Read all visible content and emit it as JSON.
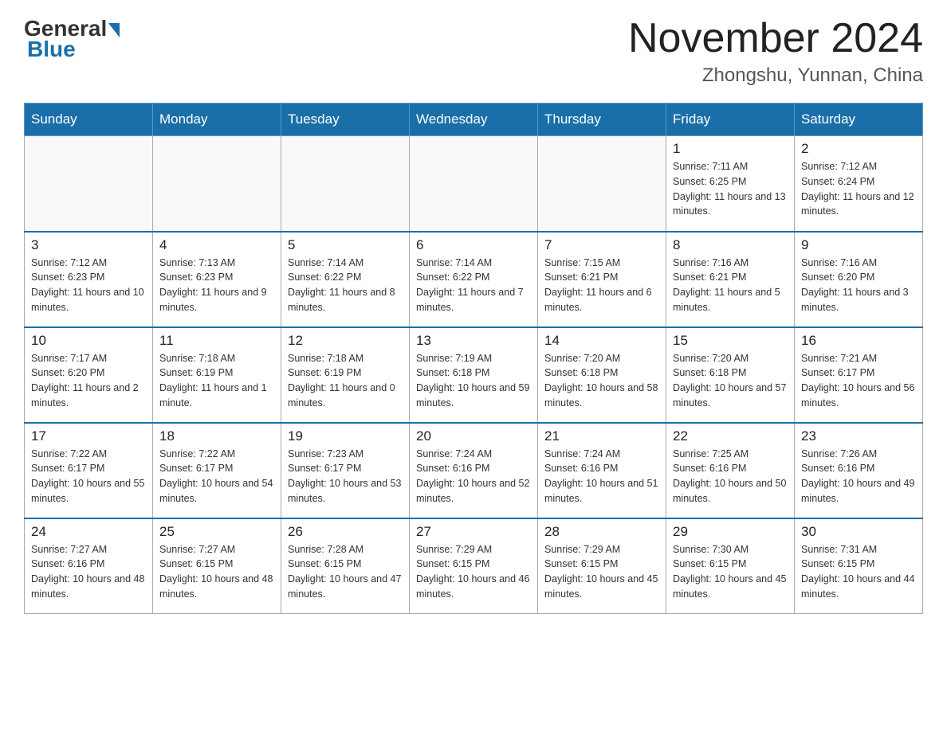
{
  "header": {
    "logo_general": "General",
    "logo_blue": "Blue",
    "month_title": "November 2024",
    "location": "Zhongshu, Yunnan, China"
  },
  "weekdays": [
    "Sunday",
    "Monday",
    "Tuesday",
    "Wednesday",
    "Thursday",
    "Friday",
    "Saturday"
  ],
  "weeks": [
    [
      {
        "day": "",
        "sunrise": "",
        "sunset": "",
        "daylight": ""
      },
      {
        "day": "",
        "sunrise": "",
        "sunset": "",
        "daylight": ""
      },
      {
        "day": "",
        "sunrise": "",
        "sunset": "",
        "daylight": ""
      },
      {
        "day": "",
        "sunrise": "",
        "sunset": "",
        "daylight": ""
      },
      {
        "day": "",
        "sunrise": "",
        "sunset": "",
        "daylight": ""
      },
      {
        "day": "1",
        "sunrise": "Sunrise: 7:11 AM",
        "sunset": "Sunset: 6:25 PM",
        "daylight": "Daylight: 11 hours and 13 minutes."
      },
      {
        "day": "2",
        "sunrise": "Sunrise: 7:12 AM",
        "sunset": "Sunset: 6:24 PM",
        "daylight": "Daylight: 11 hours and 12 minutes."
      }
    ],
    [
      {
        "day": "3",
        "sunrise": "Sunrise: 7:12 AM",
        "sunset": "Sunset: 6:23 PM",
        "daylight": "Daylight: 11 hours and 10 minutes."
      },
      {
        "day": "4",
        "sunrise": "Sunrise: 7:13 AM",
        "sunset": "Sunset: 6:23 PM",
        "daylight": "Daylight: 11 hours and 9 minutes."
      },
      {
        "day": "5",
        "sunrise": "Sunrise: 7:14 AM",
        "sunset": "Sunset: 6:22 PM",
        "daylight": "Daylight: 11 hours and 8 minutes."
      },
      {
        "day": "6",
        "sunrise": "Sunrise: 7:14 AM",
        "sunset": "Sunset: 6:22 PM",
        "daylight": "Daylight: 11 hours and 7 minutes."
      },
      {
        "day": "7",
        "sunrise": "Sunrise: 7:15 AM",
        "sunset": "Sunset: 6:21 PM",
        "daylight": "Daylight: 11 hours and 6 minutes."
      },
      {
        "day": "8",
        "sunrise": "Sunrise: 7:16 AM",
        "sunset": "Sunset: 6:21 PM",
        "daylight": "Daylight: 11 hours and 5 minutes."
      },
      {
        "day": "9",
        "sunrise": "Sunrise: 7:16 AM",
        "sunset": "Sunset: 6:20 PM",
        "daylight": "Daylight: 11 hours and 3 minutes."
      }
    ],
    [
      {
        "day": "10",
        "sunrise": "Sunrise: 7:17 AM",
        "sunset": "Sunset: 6:20 PM",
        "daylight": "Daylight: 11 hours and 2 minutes."
      },
      {
        "day": "11",
        "sunrise": "Sunrise: 7:18 AM",
        "sunset": "Sunset: 6:19 PM",
        "daylight": "Daylight: 11 hours and 1 minute."
      },
      {
        "day": "12",
        "sunrise": "Sunrise: 7:18 AM",
        "sunset": "Sunset: 6:19 PM",
        "daylight": "Daylight: 11 hours and 0 minutes."
      },
      {
        "day": "13",
        "sunrise": "Sunrise: 7:19 AM",
        "sunset": "Sunset: 6:18 PM",
        "daylight": "Daylight: 10 hours and 59 minutes."
      },
      {
        "day": "14",
        "sunrise": "Sunrise: 7:20 AM",
        "sunset": "Sunset: 6:18 PM",
        "daylight": "Daylight: 10 hours and 58 minutes."
      },
      {
        "day": "15",
        "sunrise": "Sunrise: 7:20 AM",
        "sunset": "Sunset: 6:18 PM",
        "daylight": "Daylight: 10 hours and 57 minutes."
      },
      {
        "day": "16",
        "sunrise": "Sunrise: 7:21 AM",
        "sunset": "Sunset: 6:17 PM",
        "daylight": "Daylight: 10 hours and 56 minutes."
      }
    ],
    [
      {
        "day": "17",
        "sunrise": "Sunrise: 7:22 AM",
        "sunset": "Sunset: 6:17 PM",
        "daylight": "Daylight: 10 hours and 55 minutes."
      },
      {
        "day": "18",
        "sunrise": "Sunrise: 7:22 AM",
        "sunset": "Sunset: 6:17 PM",
        "daylight": "Daylight: 10 hours and 54 minutes."
      },
      {
        "day": "19",
        "sunrise": "Sunrise: 7:23 AM",
        "sunset": "Sunset: 6:17 PM",
        "daylight": "Daylight: 10 hours and 53 minutes."
      },
      {
        "day": "20",
        "sunrise": "Sunrise: 7:24 AM",
        "sunset": "Sunset: 6:16 PM",
        "daylight": "Daylight: 10 hours and 52 minutes."
      },
      {
        "day": "21",
        "sunrise": "Sunrise: 7:24 AM",
        "sunset": "Sunset: 6:16 PM",
        "daylight": "Daylight: 10 hours and 51 minutes."
      },
      {
        "day": "22",
        "sunrise": "Sunrise: 7:25 AM",
        "sunset": "Sunset: 6:16 PM",
        "daylight": "Daylight: 10 hours and 50 minutes."
      },
      {
        "day": "23",
        "sunrise": "Sunrise: 7:26 AM",
        "sunset": "Sunset: 6:16 PM",
        "daylight": "Daylight: 10 hours and 49 minutes."
      }
    ],
    [
      {
        "day": "24",
        "sunrise": "Sunrise: 7:27 AM",
        "sunset": "Sunset: 6:16 PM",
        "daylight": "Daylight: 10 hours and 48 minutes."
      },
      {
        "day": "25",
        "sunrise": "Sunrise: 7:27 AM",
        "sunset": "Sunset: 6:15 PM",
        "daylight": "Daylight: 10 hours and 48 minutes."
      },
      {
        "day": "26",
        "sunrise": "Sunrise: 7:28 AM",
        "sunset": "Sunset: 6:15 PM",
        "daylight": "Daylight: 10 hours and 47 minutes."
      },
      {
        "day": "27",
        "sunrise": "Sunrise: 7:29 AM",
        "sunset": "Sunset: 6:15 PM",
        "daylight": "Daylight: 10 hours and 46 minutes."
      },
      {
        "day": "28",
        "sunrise": "Sunrise: 7:29 AM",
        "sunset": "Sunset: 6:15 PM",
        "daylight": "Daylight: 10 hours and 45 minutes."
      },
      {
        "day": "29",
        "sunrise": "Sunrise: 7:30 AM",
        "sunset": "Sunset: 6:15 PM",
        "daylight": "Daylight: 10 hours and 45 minutes."
      },
      {
        "day": "30",
        "sunrise": "Sunrise: 7:31 AM",
        "sunset": "Sunset: 6:15 PM",
        "daylight": "Daylight: 10 hours and 44 minutes."
      }
    ]
  ]
}
